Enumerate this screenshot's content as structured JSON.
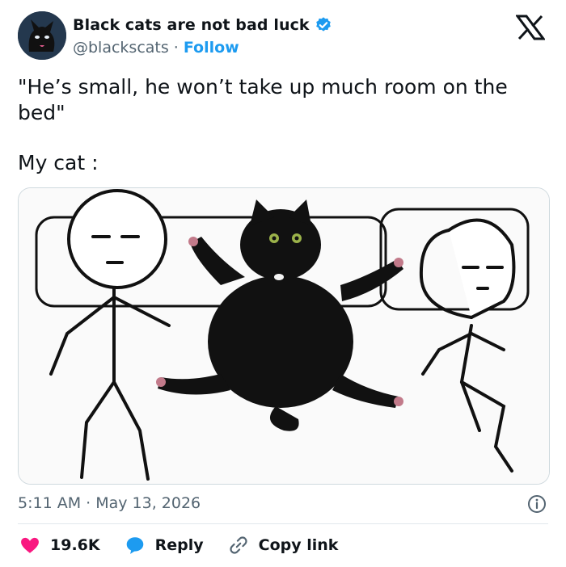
{
  "tweet": {
    "author_name": "Black cats are not bad luck",
    "handle": "@blackscats",
    "separator": "·",
    "follow_label": "Follow",
    "text_line1": "\"He’s small, he won’t take up much room on the bed\"",
    "text_line2": "My cat :",
    "timestamp": "5:11 AM · May 13, 2026"
  },
  "actions": {
    "like_count": "19.6K",
    "reply_label": "Reply",
    "copy_link_label": "Copy link"
  },
  "colors": {
    "like": "#f91880",
    "verified": "#1d9bf0",
    "follow": "#1d9bf0",
    "reply_bubble": "#1d9bf0"
  },
  "icons": [
    "avatar-cat",
    "verified-badge-icon",
    "x-logo-icon",
    "info-icon",
    "heart-icon",
    "reply-bubble-icon",
    "link-icon"
  ]
}
